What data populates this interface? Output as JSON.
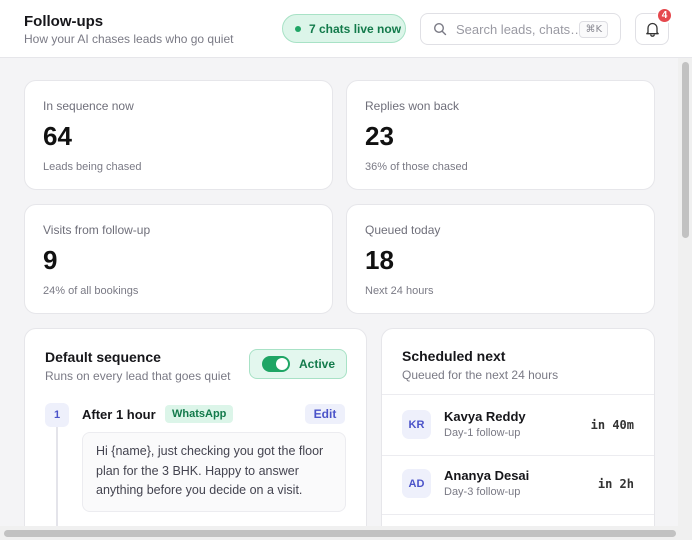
{
  "header": {
    "title": "Follow-ups",
    "subtitle": "How your AI chases leads who go quiet",
    "live_status": "7 chats live now",
    "search_placeholder": "Search leads, chats…",
    "search_shortcut": "⌘K",
    "notification_count": "4"
  },
  "stats": [
    {
      "label": "In sequence now",
      "value": "64",
      "note": "Leads being chased"
    },
    {
      "label": "Replies won back",
      "value": "23",
      "note": "36% of those chased"
    },
    {
      "label": "Visits from follow-up",
      "value": "9",
      "note": "24% of all bookings"
    },
    {
      "label": "Queued today",
      "value": "18",
      "note": "Next 24 hours"
    }
  ],
  "sequence": {
    "title": "Default sequence",
    "subtitle": "Runs on every lead that goes quiet",
    "toggle_label": "Active",
    "steps": [
      {
        "number": "1",
        "title": "After 1 hour",
        "channel": "WhatsApp",
        "edit_label": "Edit",
        "message": "Hi {name}, just checking you got the floor plan for the 3 BHK. Happy to answer anything before you decide on a visit."
      }
    ]
  },
  "scheduled": {
    "title": "Scheduled next",
    "subtitle": "Queued for the next 24 hours",
    "items": [
      {
        "initials": "KR",
        "name": "Kavya Reddy",
        "step": "Day-1 follow-up",
        "eta": "in 40m"
      },
      {
        "initials": "AD",
        "name": "Ananya Desai",
        "step": "Day-3 follow-up",
        "eta": "in 2h"
      }
    ]
  },
  "colors": {
    "accent": "#4b53c9",
    "success": "#1fa565",
    "danger": "#e5484d"
  }
}
